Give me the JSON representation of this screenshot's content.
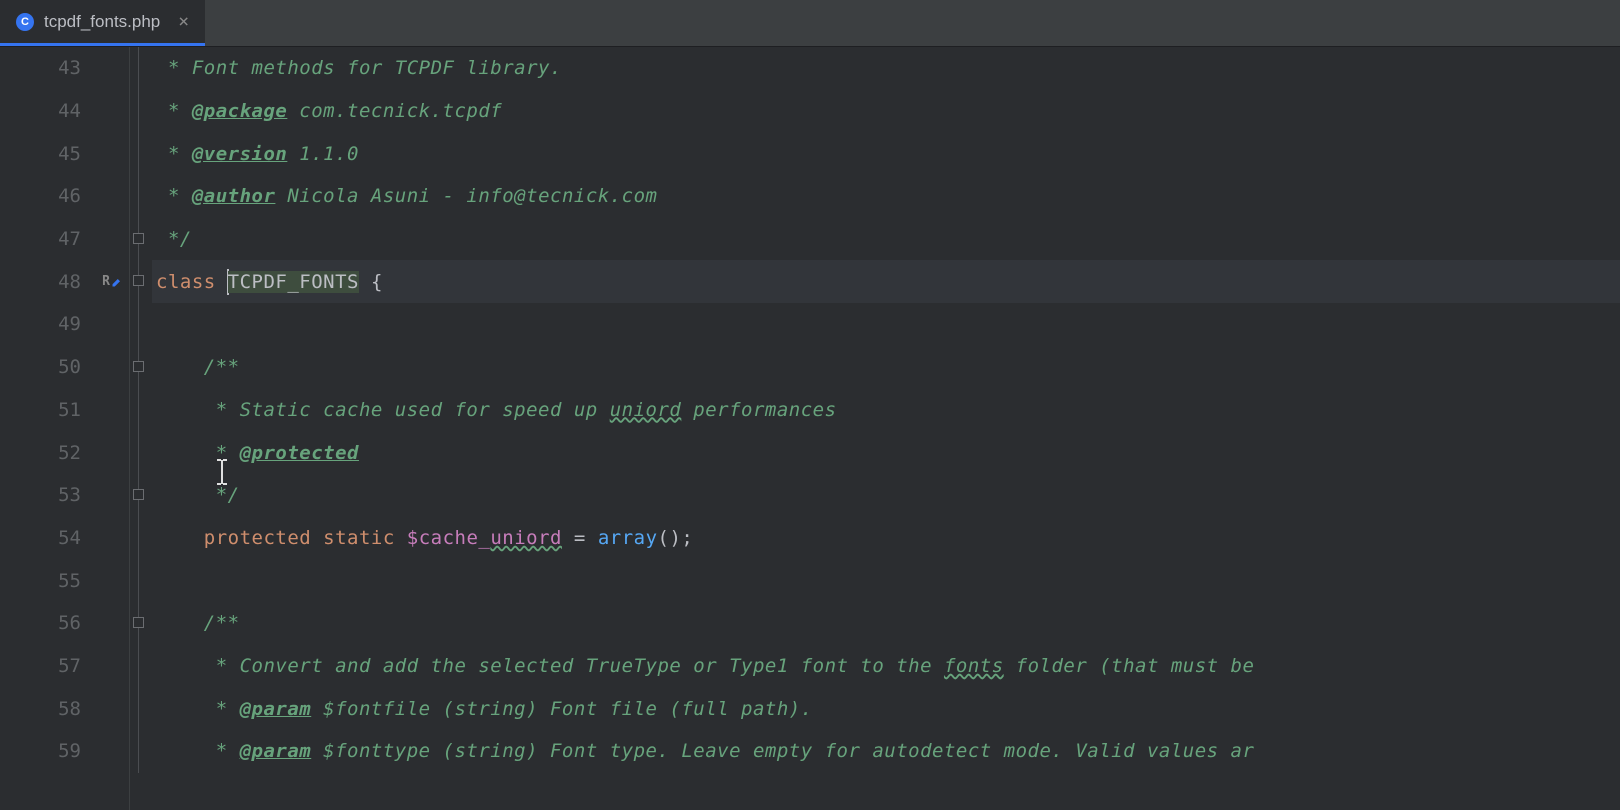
{
  "tab": {
    "icon_letter": "C",
    "file_name": "tcpdf_fonts.php",
    "close_glyph": "×"
  },
  "gutter": {
    "start": 43,
    "end": 59,
    "edit_marker_line": 48
  },
  "code": {
    "l43": {
      "prefix": " * ",
      "text": "Font methods for TCPDF library."
    },
    "l44": {
      "prefix": " * ",
      "tag": "@package",
      "rest": " com.tecnick.tcpdf"
    },
    "l45": {
      "prefix": " * ",
      "tag": "@version",
      "rest": " 1.1.0"
    },
    "l46": {
      "prefix": " * ",
      "tag": "@author",
      "rest": " Nicola Asuni - info@tecnick.com"
    },
    "l47": {
      "text": " */"
    },
    "l48": {
      "kw": "class",
      "name": "TCPDF_FONTS",
      "brace": " {"
    },
    "l49": {
      "text": ""
    },
    "l50": {
      "text": "    /**"
    },
    "l51": {
      "prefix": "     * ",
      "t1": "Static cache used for speed up ",
      "sq": "uniord",
      "t2": " performances"
    },
    "l52": {
      "prefix": "     * ",
      "tag": "@protected"
    },
    "l53": {
      "text": "     */"
    },
    "l54": {
      "kw1": "protected",
      "kw2": "static",
      "var": "$cache_",
      "varsq": "uniord",
      "eq": " = ",
      "func": "array",
      "tail": "();"
    },
    "l55": {
      "text": ""
    },
    "l56": {
      "text": "    /**"
    },
    "l57": {
      "prefix": "     * ",
      "t1": "Convert and add the selected TrueType or Type1 font to the ",
      "sq": "fonts",
      "t2": " folder (that must be "
    },
    "l58": {
      "prefix": "     * ",
      "tag": "@param",
      "rest": " $fontfile (string) Font file (full path)."
    },
    "l59": {
      "prefix": "     * ",
      "tag": "@param",
      "rest": " $fonttype (string) Font type. Leave empty for autodetect mode. Valid values ar"
    }
  }
}
